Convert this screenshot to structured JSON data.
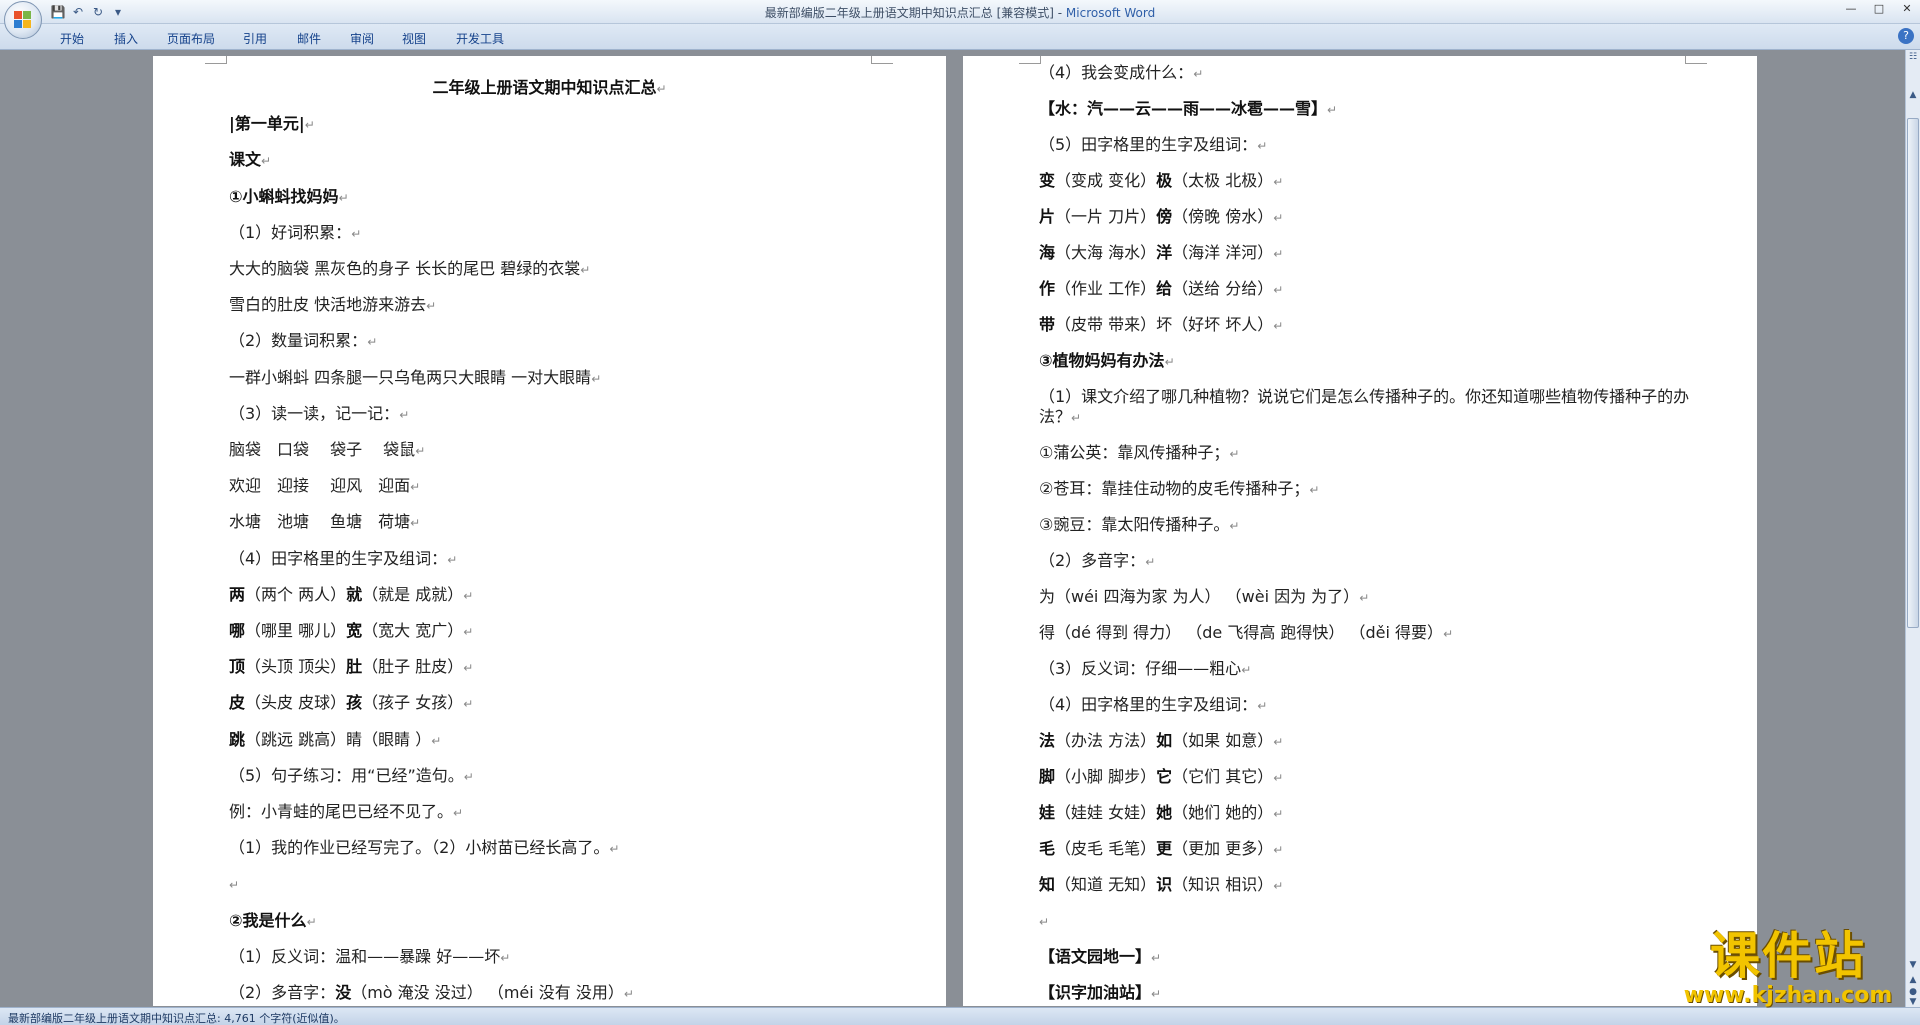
{
  "window": {
    "title": "最新部编版二年级上册语文期中知识点汇总 [兼容模式] - ",
    "app_name": "Microsoft Word"
  },
  "ribbon_tabs": [
    "开始",
    "插入",
    "页面布局",
    "引用",
    "邮件",
    "审阅",
    "视图",
    "开发工具"
  ],
  "left_page": [
    {
      "text": "二年级上册语文期中知识点汇总",
      "style": "title"
    },
    {
      "text": "|第一单元|",
      "style": "heading"
    },
    {
      "text": "课文",
      "style": "heading"
    },
    {
      "text": "①小蝌蚪找妈妈",
      "style": "heading"
    },
    {
      "text": "（1）好词积累：",
      "style": "normal"
    },
    {
      "text": "大大的脑袋 黑灰色的身子 长长的尾巴 碧绿的衣裳",
      "style": "normal"
    },
    {
      "text": "雪白的肚皮 快活地游来游去",
      "style": "normal"
    },
    {
      "text": "（2）数量词积累：",
      "style": "normal"
    },
    {
      "text": "一群小蝌蚪 四条腿一只乌龟两只大眼睛 一对大眼睛",
      "style": "normal"
    },
    {
      "text": "（3）读一读，记一记：",
      "style": "normal"
    },
    {
      "text": "脑袋　口袋　 袋子　 袋鼠",
      "style": "normal"
    },
    {
      "text": "欢迎　迎接　 迎风　迎面",
      "style": "normal"
    },
    {
      "text": "水塘　池塘　 鱼塘　荷塘",
      "style": "normal"
    },
    {
      "text": "（4）田字格里的生字及组词：",
      "style": "normal"
    },
    {
      "parts": [
        {
          "t": "两",
          "b": true
        },
        {
          "t": "（两个 两人）"
        },
        {
          "t": "就",
          "b": true
        },
        {
          "t": "（就是 成就）"
        }
      ]
    },
    {
      "parts": [
        {
          "t": "哪",
          "b": true
        },
        {
          "t": "（哪里 哪儿）"
        },
        {
          "t": "宽",
          "b": true
        },
        {
          "t": "（宽大 宽广）"
        }
      ]
    },
    {
      "parts": [
        {
          "t": "顶",
          "b": true
        },
        {
          "t": "（头顶 顶尖）"
        },
        {
          "t": "肚",
          "b": true
        },
        {
          "t": "（肚子 肚皮）"
        }
      ]
    },
    {
      "parts": [
        {
          "t": "皮",
          "b": true
        },
        {
          "t": "（头皮 皮球）"
        },
        {
          "t": "孩",
          "b": true
        },
        {
          "t": "（孩子 女孩）"
        }
      ]
    },
    {
      "parts": [
        {
          "t": "跳",
          "b": true
        },
        {
          "t": "（跳远 跳高）睛（眼睛 ）"
        }
      ]
    },
    {
      "text": "（5）句子练习：用“已经”造句。",
      "style": "normal"
    },
    {
      "text": "例：小青蛙的尾巴已经不见了。",
      "style": "normal"
    },
    {
      "text": "（1）我的作业已经写完了。（2）小树苗已经长高了。",
      "style": "normal"
    },
    {
      "text": "",
      "style": "normal"
    },
    {
      "text": "②我是什么",
      "style": "heading"
    },
    {
      "text": "（1）反义词：温和——暴躁 好——坏",
      "style": "normal"
    },
    {
      "parts": [
        {
          "t": "（2）多音字："
        },
        {
          "t": "没",
          "b": true
        },
        {
          "t": "（mò 淹没 没过） （méi 没有 没用）"
        }
      ]
    }
  ],
  "right_page": [
    {
      "text": "（4）我会变成什么：",
      "style": "normal"
    },
    {
      "text": "【水：汽——云——雨——冰雹——雪】",
      "style": "heading"
    },
    {
      "text": "（5）田字格里的生字及组词：",
      "style": "normal"
    },
    {
      "parts": [
        {
          "t": "变",
          "b": true
        },
        {
          "t": "（变成 变化）"
        },
        {
          "t": "极",
          "b": true
        },
        {
          "t": "（太极 北极）"
        }
      ]
    },
    {
      "parts": [
        {
          "t": "片",
          "b": true
        },
        {
          "t": "（一片 刀片）"
        },
        {
          "t": "傍",
          "b": true
        },
        {
          "t": "（傍晚 傍水）"
        }
      ]
    },
    {
      "parts": [
        {
          "t": "海",
          "b": true
        },
        {
          "t": "（大海 海水）"
        },
        {
          "t": "洋",
          "b": true
        },
        {
          "t": "（海洋 洋河）"
        }
      ]
    },
    {
      "parts": [
        {
          "t": "作",
          "b": true
        },
        {
          "t": "（作业 工作）"
        },
        {
          "t": "给",
          "b": true
        },
        {
          "t": "（送给 分给）"
        }
      ]
    },
    {
      "parts": [
        {
          "t": "带",
          "b": true
        },
        {
          "t": "（皮带 带来）坏（好坏 坏人）"
        }
      ]
    },
    {
      "text": "③植物妈妈有办法",
      "style": "heading"
    },
    {
      "text": "（1）课文介绍了哪几种植物？说说它们是怎么传播种子的。你还知道哪些植物传播种子的办法？",
      "style": "wrap"
    },
    {
      "text": "①蒲公英：靠风传播种子；",
      "style": "normal"
    },
    {
      "text": "②苍耳：靠挂住动物的皮毛传播种子；",
      "style": "normal"
    },
    {
      "text": "③豌豆：靠太阳传播种子。",
      "style": "normal"
    },
    {
      "text": "（2）多音字：",
      "style": "normal"
    },
    {
      "text": "为（wéi 四海为家 为人） （wèi 因为 为了）",
      "style": "normal"
    },
    {
      "text": "得（dé 得到 得力） （de 飞得高 跑得快） （děi 得要）",
      "style": "normal"
    },
    {
      "text": "（3）反义词：仔细——粗心",
      "style": "normal"
    },
    {
      "text": "（4）田字格里的生字及组词：",
      "style": "normal"
    },
    {
      "parts": [
        {
          "t": "法",
          "b": true
        },
        {
          "t": "（办法 方法）"
        },
        {
          "t": "如",
          "b": true
        },
        {
          "t": "（如果 如意）"
        }
      ]
    },
    {
      "parts": [
        {
          "t": "脚",
          "b": true
        },
        {
          "t": "（小脚 脚步）"
        },
        {
          "t": "它",
          "b": true
        },
        {
          "t": "（它们 其它）"
        }
      ]
    },
    {
      "parts": [
        {
          "t": "娃",
          "b": true
        },
        {
          "t": "（娃娃 女娃）"
        },
        {
          "t": "她",
          "b": true
        },
        {
          "t": "（她们 她的）"
        }
      ]
    },
    {
      "parts": [
        {
          "t": "毛",
          "b": true
        },
        {
          "t": "（皮毛 毛笔）"
        },
        {
          "t": "更",
          "b": true
        },
        {
          "t": "（更加 更多）"
        }
      ]
    },
    {
      "parts": [
        {
          "t": "知",
          "b": true
        },
        {
          "t": "（知道 无知）"
        },
        {
          "t": "识",
          "b": true
        },
        {
          "t": "（知识 相识）"
        }
      ]
    },
    {
      "text": "",
      "style": "normal"
    },
    {
      "text": "【语文园地一】",
      "style": "heading"
    },
    {
      "text": "【识字加油站】",
      "style": "heading"
    }
  ],
  "status_bar": {
    "text": "最新部编版二年级上册语文期中知识点汇总: 4,761 个字符(近似值)。"
  },
  "watermark": {
    "name": "课件站",
    "url": "www.kjzhan.com"
  },
  "colors": {
    "accent": "#2f5fa8",
    "watermark": "#f2c400"
  }
}
